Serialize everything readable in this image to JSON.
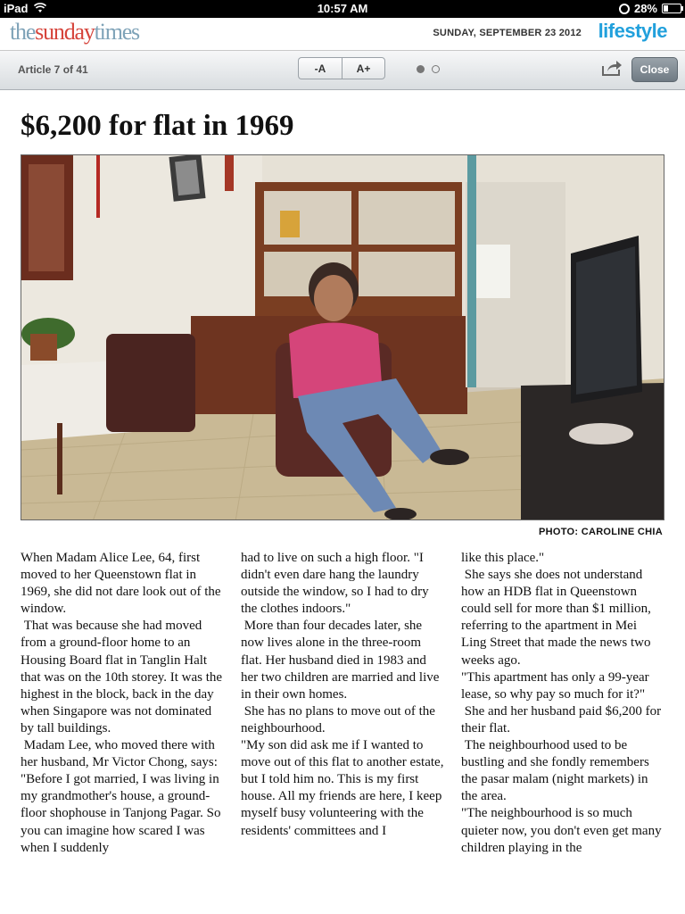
{
  "status_bar": {
    "device": "iPad",
    "time": "10:57 AM",
    "battery": "28%",
    "battery_level": 0.28
  },
  "masthead": {
    "logo": {
      "the": "the",
      "sunday": "sunday",
      "times": "times"
    },
    "date": "SUNDAY, SEPTEMBER 23 2012",
    "section": "lifestyle"
  },
  "toolbar": {
    "article_count": "Article 7 of 41",
    "decrease_text": "-A",
    "increase_text": "A+",
    "page_dots": {
      "total": 2,
      "current": 1
    },
    "close_label": "Close"
  },
  "article": {
    "headline": "$6,200 for flat in 1969",
    "photo_credit": "PHOTO: CAROLINE CHIA",
    "columns": [
      [
        "When Madam Alice Lee, 64, first moved to her Queenstown flat in 1969, she did not dare look out of the window.",
        " That was because she had moved from a ground-floor home to an Housing Board flat in Tanglin Halt that was on the 10th storey. It was the highest in the block, back in the day when Singapore was not dominated by tall buildings.",
        " Madam Lee, who moved there with her husband, Mr Victor Chong, says: \"Before I got married, I was living in my grandmother's house, a ground-floor shophouse in Tanjong Pagar. So you can imagine how scared I was when I suddenly"
      ],
      [
        "had to live on such a high floor. \"I didn't even dare hang the laundry outside the window, so I had to dry the clothes indoors.\"",
        " More than four decades later, she now lives alone in the three-room flat. Her husband died in 1983 and her two children are married and live in their own homes.",
        " She has no plans to move out of the neighbourhood.",
        "\"My son did ask me if I wanted to move out of this flat to another estate, but I told him no. This is my first house. All my friends are here, I keep myself busy volunteering with the residents' committees and I"
      ],
      [
        "like this place.\"",
        " She says she does not understand how an HDB flat in Queenstown could sell for more than $1 million, referring to the apartment in Mei Ling Street that made the news two weeks ago.",
        "\"This apartment has only a 99-year lease, so why pay so much for it?\"",
        " She and her husband paid $6,200 for their flat.",
        " The neighbourhood used to be bustling and she fondly remembers the pasar malam (night markets) in the area.",
        "\"The neighbourhood is so much quieter now, you don't even get many children playing in the"
      ]
    ]
  }
}
